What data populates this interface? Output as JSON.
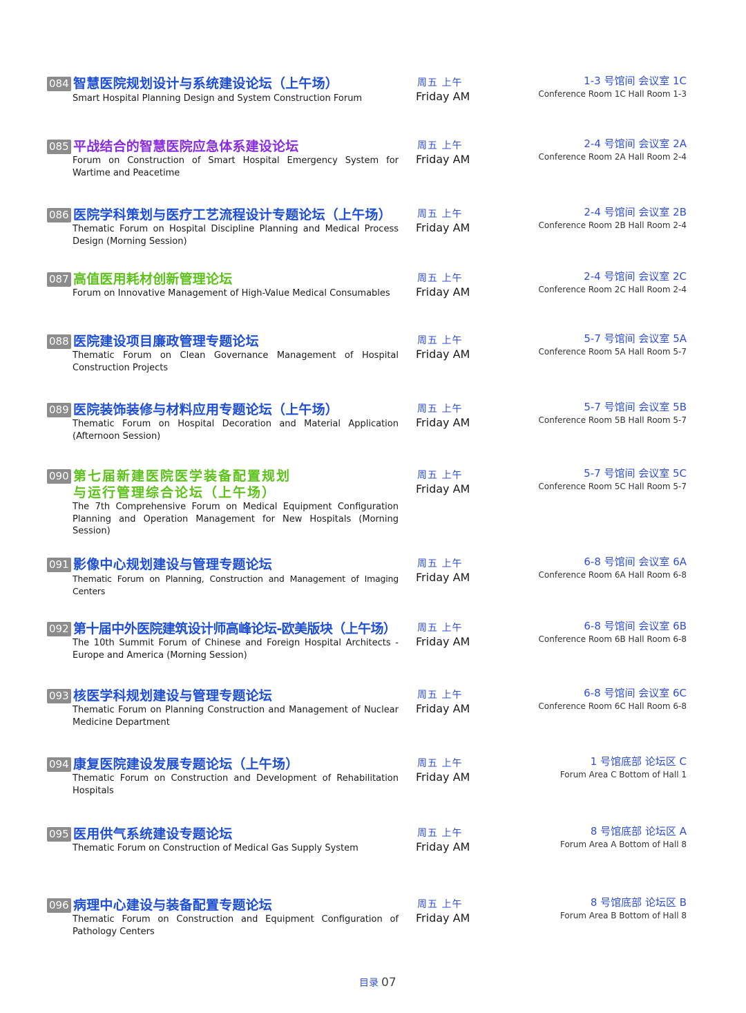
{
  "colors": {
    "blue": "#1d4ed8",
    "purple": "#8a2be2",
    "green": "#5cc21a",
    "badge": "#8c8c8c",
    "accent": "#2f4fd8"
  },
  "forums": [
    {
      "num": "084",
      "title": "智慧医院规划设计与系统建设论坛（上午场）",
      "title_color": "blue",
      "en": "Smart Hospital Planning Design and System Construction Forum",
      "day_zh": "周五 上午",
      "day_en": "Friday AM",
      "loc_zh": "1-3 号馆间 会议室 1C",
      "loc_en": "Conference Room 1C Hall Room 1-3"
    },
    {
      "num": "085",
      "title": "平战结合的智慧医院应急体系建设论坛",
      "title_color": "purple",
      "en": "Forum on Construction of  Smart Hospital Emergency System for Wartime and Peacetime",
      "day_zh": "周五 上午",
      "day_en": "Friday AM",
      "loc_zh": "2-4 号馆间 会议室 2A",
      "loc_en": "Conference Room 2A Hall Room 2-4"
    },
    {
      "num": "086",
      "title": "医院学科策划与医疗工艺流程设计专题论坛（上午场）",
      "title_color": "blue",
      "en": "Thematic Forum on Hospital Discipline Planning and Medical Process Design (Morning Session)",
      "day_zh": "周五 上午",
      "day_en": "Friday AM",
      "loc_zh": "2-4 号馆间 会议室 2B",
      "loc_en": "Conference Room 2B Hall Room 2-4"
    },
    {
      "num": "087",
      "title": "高值医用耗材创新管理论坛",
      "title_color": "green",
      "en": "Forum on Innovative Management of High-Value Medical Consumables",
      "day_zh": "周五 上午",
      "day_en": "Friday AM",
      "loc_zh": "2-4 号馆间 会议室 2C",
      "loc_en": "Conference Room 2C Hall Room 2-4"
    },
    {
      "num": "088",
      "title": "医院建设项目廉政管理专题论坛",
      "title_color": "blue",
      "en": "Thematic Forum on Clean Governance Management of Hospital Construction Projects",
      "day_zh": "周五 上午",
      "day_en": "Friday AM",
      "loc_zh": "5-7 号馆间 会议室 5A",
      "loc_en": "Conference Room 5A Hall Room 5-7"
    },
    {
      "num": "089",
      "title": "医院装饰装修与材料应用专题论坛（上午场）",
      "title_color": "blue",
      "en": "Thematic Forum on Hospital Decoration and Material Application (Afternoon Session)",
      "day_zh": "周五 上午",
      "day_en": "Friday AM",
      "loc_zh": "5-7 号馆间 会议室 5B",
      "loc_en": "Conference Room 5B Hall Room 5-7"
    },
    {
      "num": "090",
      "title": "第七届新建医院医学装备配置规划",
      "title2": "与运行管理综合论坛（上午场）",
      "title_color": "green",
      "en": "The 7th Comprehensive Forum on Medical Equipment Configuration Planning and Operation Management for New Hospitals (Morning Session)",
      "day_zh": "周五 上午",
      "day_en": "Friday AM",
      "loc_zh": "5-7 号馆间 会议室 5C",
      "loc_en": "Conference Room 5C Hall Room 5-7"
    },
    {
      "num": "091",
      "title": "影像中心规划建设与管理专题论坛",
      "title_color": "blue",
      "en": "Thematic Forum on Planning, Construction and Management of Imaging Centers",
      "day_zh": "周五 上午",
      "day_en": "Friday AM",
      "loc_zh": "6-8 号馆间 会议室 6A",
      "loc_en": "Conference Room 6A Hall Room 6-8"
    },
    {
      "num": "092",
      "title": "第十届中外医院建筑设计师高峰论坛-欧美版块（上午场）",
      "title_color": "blue",
      "en": "The 10th Summit Forum of Chinese and Foreign Hospital Architects - Europe and America (Morning Session)",
      "day_zh": "周五 上午",
      "day_en": "Friday AM",
      "loc_zh": "6-8 号馆间 会议室 6B",
      "loc_en": "Conference Room 6B Hall Room 6-8"
    },
    {
      "num": "093",
      "title": "核医学科规划建设与管理专题论坛",
      "title_color": "blue",
      "en": "Thematic Forum on Planning Construction and Management of Nuclear Medicine Department",
      "day_zh": "周五 上午",
      "day_en": "Friday AM",
      "loc_zh": "6-8 号馆间 会议室 6C",
      "loc_en": "Conference Room 6C Hall Room 6-8"
    },
    {
      "num": "094",
      "title": "康复医院建设发展专题论坛（上午场）",
      "title_color": "blue",
      "en": "Thematic Forum on Construction and Development of Rehabilitation Hospitals",
      "day_zh": "周五 上午",
      "day_en": "Friday AM",
      "loc_zh": "1 号馆底部 论坛区 C",
      "loc_en": "Forum Area C Bottom of Hall 1"
    },
    {
      "num": "095",
      "title": "医用供气系统建设专题论坛",
      "title_color": "blue",
      "en": "Thematic Forum on Construction of Medical Gas Supply System",
      "day_zh": "周五 上午",
      "day_en": "Friday AM",
      "loc_zh": "8 号馆底部 论坛区 A",
      "loc_en": "Forum Area A Bottom of Hall 8"
    },
    {
      "num": "096",
      "title": "病理中心建设与装备配置专题论坛",
      "title_color": "blue",
      "en": "Thematic Forum on Construction and Equipment Configuration of Pathology Centers",
      "day_zh": "周五 上午",
      "day_en": "Friday AM",
      "loc_zh": "8 号馆底部 论坛区 B",
      "loc_en": "Forum Area B Bottom of Hall 8"
    }
  ],
  "footer": {
    "label": "目录",
    "page": "07"
  }
}
